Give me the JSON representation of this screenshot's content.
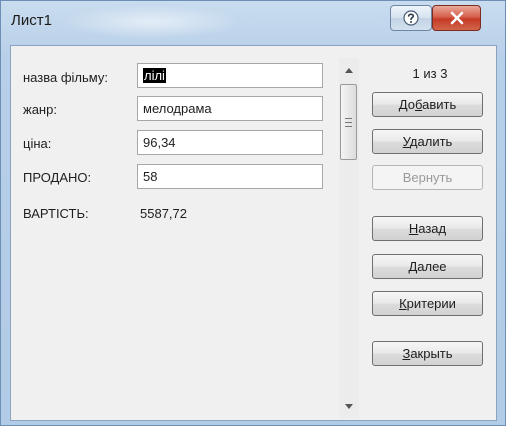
{
  "window": {
    "title": "Лист1"
  },
  "form": {
    "fields": [
      {
        "label": "назва фільму:",
        "value": "лілі",
        "selected": true
      },
      {
        "label": "жанр:",
        "value": "мелодрама"
      },
      {
        "label": "ціна:",
        "value": "96,34"
      },
      {
        "label": "ПРОДАНО:",
        "value": "58"
      }
    ],
    "computed": {
      "label": "ВАРТІСТЬ:",
      "value": "5587,72"
    }
  },
  "record_counter": "1 из 3",
  "buttons": {
    "add": {
      "pre": "До",
      "accel": "б",
      "post": "авить"
    },
    "delete": {
      "pre": "",
      "accel": "У",
      "post": "далить"
    },
    "restore": {
      "label": "Вернуть"
    },
    "back": {
      "pre": "",
      "accel": "Н",
      "post": "азад"
    },
    "next": {
      "pre": "",
      "accel": "Д",
      "post": "алее"
    },
    "criteria": {
      "pre": "",
      "accel": "К",
      "post": "ритерии"
    },
    "close": {
      "pre": "",
      "accel": "З",
      "post": "акрыть"
    }
  },
  "icons": {
    "help": "help-question-icon",
    "close": "close-x-icon",
    "scroll_up": "scroll-up-arrow-icon",
    "scroll_down": "scroll-down-arrow-icon"
  },
  "colors": {
    "title_bar": "#b7cfe8",
    "close_button": "#c43b26",
    "client_bg": "#f0f0f0"
  }
}
